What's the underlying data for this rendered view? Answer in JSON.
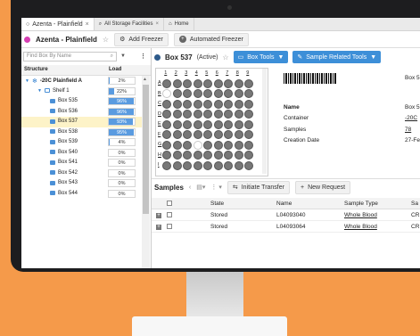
{
  "tabs": [
    {
      "icon": "circle-icon",
      "label": "Azenta - Plainfield",
      "close": "×"
    },
    {
      "icon": "search-icon",
      "label": "All Storage Facilities",
      "close": "×"
    },
    {
      "icon": "home-icon",
      "label": "Home",
      "close": ""
    }
  ],
  "toolbar": {
    "title": "Azenta - Plainfield",
    "star": "☆",
    "add_freezer": "Add Freezer",
    "automated_freezer": "Automated Freezer"
  },
  "sidebar": {
    "find_placeholder": "Find Box By Name",
    "col_structure": "Structure",
    "col_load": "Load",
    "items": [
      {
        "label": "-20C Plainfield A",
        "load": "2%",
        "level": 0.02,
        "indent": 0,
        "type": "freezer",
        "selected": false
      },
      {
        "label": "Shelf 1",
        "load": "22%",
        "level": 0.22,
        "indent": 1,
        "type": "shelf",
        "selected": false
      },
      {
        "label": "Box 535",
        "load": "96%",
        "level": 0.96,
        "indent": 2,
        "type": "box",
        "selected": false
      },
      {
        "label": "Box 536",
        "load": "96%",
        "level": 0.96,
        "indent": 2,
        "type": "box",
        "selected": false
      },
      {
        "label": "Box 537",
        "load": "93%",
        "level": 0.93,
        "indent": 2,
        "type": "box",
        "selected": true
      },
      {
        "label": "Box 538",
        "load": "95%",
        "level": 0.95,
        "indent": 2,
        "type": "box",
        "selected": false
      },
      {
        "label": "Box 539",
        "load": "4%",
        "level": 0.04,
        "indent": 2,
        "type": "box",
        "selected": false
      },
      {
        "label": "Box 540",
        "load": "0%",
        "level": 0,
        "indent": 2,
        "type": "box",
        "selected": false
      },
      {
        "label": "Box 541",
        "load": "0%",
        "level": 0,
        "indent": 2,
        "type": "box",
        "selected": false
      },
      {
        "label": "Box 542",
        "load": "0%",
        "level": 0,
        "indent": 2,
        "type": "box",
        "selected": false
      },
      {
        "label": "Box 543",
        "load": "0%",
        "level": 0,
        "indent": 2,
        "type": "box",
        "selected": false
      },
      {
        "label": "Box 544",
        "load": "0%",
        "level": 0,
        "indent": 2,
        "type": "box",
        "selected": false
      }
    ]
  },
  "box": {
    "name": "Box 537",
    "status": "(Active)",
    "star": "☆",
    "box_tools": "Box Tools",
    "sample_tools": "Sample Related Tools",
    "col_labels": [
      "1",
      "2",
      "3",
      "4",
      "5",
      "6",
      "7",
      "8",
      "9"
    ],
    "row_labels": [
      "A",
      "B",
      "C",
      "D",
      "E",
      "F",
      "G",
      "H",
      "I"
    ],
    "wells": [
      "111111111",
      "011111111",
      "111111111",
      "111111111",
      "111111111",
      "111111111",
      "111011111",
      "111111111",
      "111111111"
    ],
    "right_cut": "Box 5",
    "properties": [
      {
        "key": "Name",
        "value": "Box 5",
        "bold": true,
        "link": false
      },
      {
        "key": "Container",
        "value": "-20C",
        "bold": false,
        "link": true
      },
      {
        "key": "Samples",
        "value": "78",
        "bold": false,
        "link": true
      },
      {
        "key": "Creation Date",
        "value": "27-Fe",
        "bold": false,
        "link": false
      }
    ]
  },
  "samples": {
    "title": "Samples",
    "initiate_transfer": "Initiate Transfer",
    "new_request": "New Request",
    "columns": [
      "State",
      "Name",
      "Sample Type",
      "Sa"
    ],
    "rows": [
      {
        "state": "Stored",
        "name": "L04093040",
        "type": "Whole Blood",
        "sa": "CR"
      },
      {
        "state": "Stored",
        "name": "L04093064",
        "type": "Whole Blood",
        "sa": "CR"
      }
    ]
  }
}
